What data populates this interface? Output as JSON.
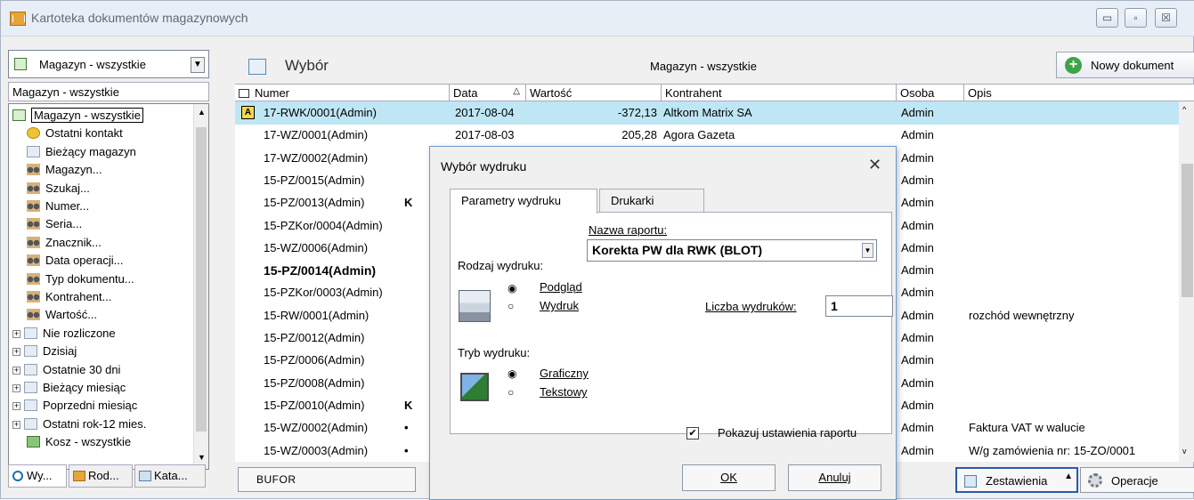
{
  "window": {
    "title": "Kartoteka dokumentów magazynowych",
    "min": "▭",
    "max": "▫",
    "close": "☒"
  },
  "left": {
    "combo": "Magazyn - wszystkie",
    "header": "Magazyn - wszystkie",
    "tree": [
      {
        "label": "Magazyn - wszystkie",
        "icon": "magazine-icon",
        "level": 0,
        "exp": ""
      },
      {
        "label": "Ostatni kontakt",
        "icon": "clock-icon",
        "level": 1,
        "exp": ""
      },
      {
        "label": "Bieżący magazyn",
        "icon": "grid-icon",
        "level": 1,
        "exp": ""
      },
      {
        "label": "Magazyn...",
        "icon": "binoculars-icon",
        "level": 1,
        "exp": ""
      },
      {
        "label": "Szukaj...",
        "icon": "binoculars-icon",
        "level": 1,
        "exp": ""
      },
      {
        "label": "Numer...",
        "icon": "binoculars-icon",
        "level": 1,
        "exp": ""
      },
      {
        "label": "Seria...",
        "icon": "binoculars-icon",
        "level": 1,
        "exp": ""
      },
      {
        "label": "Znacznik...",
        "icon": "binoculars-icon",
        "level": 1,
        "exp": ""
      },
      {
        "label": "Data operacji...",
        "icon": "binoculars-icon",
        "level": 1,
        "exp": ""
      },
      {
        "label": "Typ dokumentu...",
        "icon": "binoculars-icon",
        "level": 1,
        "exp": ""
      },
      {
        "label": "Kontrahent...",
        "icon": "binoculars-icon",
        "level": 1,
        "exp": ""
      },
      {
        "label": "Wartość...",
        "icon": "binoculars-icon",
        "level": 1,
        "exp": ""
      },
      {
        "label": "Nie rozliczone",
        "icon": "grid-icon",
        "level": 0,
        "exp": "+"
      },
      {
        "label": "Dzisiaj",
        "icon": "grid-icon",
        "level": 0,
        "exp": "+"
      },
      {
        "label": "Ostatnie 30 dni",
        "icon": "grid-icon",
        "level": 0,
        "exp": "+"
      },
      {
        "label": "Bieżący miesiąc",
        "icon": "grid-icon",
        "level": 0,
        "exp": "+"
      },
      {
        "label": "Poprzedni miesiąc",
        "icon": "grid-icon",
        "level": 0,
        "exp": "+"
      },
      {
        "label": "Ostatni rok-12 mies.",
        "icon": "grid-icon",
        "level": 0,
        "exp": "+"
      },
      {
        "label": "Kosz - wszystkie",
        "icon": "bin-icon",
        "level": 1,
        "exp": ""
      }
    ],
    "tabs": [
      "Wy...",
      "Rod...",
      "Kata..."
    ]
  },
  "main": {
    "title": "Wybór",
    "subtitle": "Magazyn - wszystkie",
    "new_doc": "Nowy dokument",
    "columns": [
      "Numer",
      "Data",
      "Wartość",
      "Kontrahent",
      "Osoba",
      "Opis"
    ],
    "rows": [
      {
        "flag": "A",
        "mark": "",
        "numer": "17-RWK/0001(Admin)",
        "data": "2017-08-04",
        "wartosc": "-372,13",
        "kontrahent": "Altkom Matrix SA",
        "osoba": "Admin",
        "opis": "",
        "bold": false
      },
      {
        "flag": "",
        "mark": "",
        "numer": "17-WZ/0001(Admin)",
        "data": "2017-08-03",
        "wartosc": "205,28",
        "kontrahent": "Agora Gazeta",
        "osoba": "Admin",
        "opis": "",
        "bold": false
      },
      {
        "flag": "",
        "mark": "",
        "numer": "17-WZ/0002(Admin)",
        "data": "",
        "wartosc": "",
        "kontrahent": "",
        "osoba": "Admin",
        "opis": "",
        "bold": false
      },
      {
        "flag": "",
        "mark": "",
        "numer": "15-PZ/0015(Admin)",
        "data": "",
        "wartosc": "",
        "kontrahent": "",
        "osoba": "Admin",
        "opis": "",
        "bold": false
      },
      {
        "flag": "",
        "mark": "K",
        "numer": "15-PZ/0013(Admin)",
        "data": "",
        "wartosc": "",
        "kontrahent": "",
        "osoba": "Admin",
        "opis": "",
        "bold": false
      },
      {
        "flag": "",
        "mark": "",
        "numer": "15-PZKor/0004(Admin)",
        "data": "",
        "wartosc": "",
        "kontrahent": "",
        "osoba": "Admin",
        "opis": "",
        "bold": false
      },
      {
        "flag": "",
        "mark": "",
        "numer": "15-WZ/0006(Admin)",
        "data": "",
        "wartosc": "",
        "kontrahent": "",
        "osoba": "Admin",
        "opis": "",
        "bold": false
      },
      {
        "flag": "",
        "mark": "",
        "numer": "15-PZ/0014(Admin)",
        "data": "",
        "wartosc": "",
        "kontrahent": "",
        "osoba": "Admin",
        "opis": "",
        "bold": true
      },
      {
        "flag": "",
        "mark": "",
        "numer": "15-PZKor/0003(Admin)",
        "data": "",
        "wartosc": "",
        "kontrahent": "",
        "osoba": "Admin",
        "opis": "",
        "bold": false
      },
      {
        "flag": "",
        "mark": "",
        "numer": "15-RW/0001(Admin)",
        "data": "",
        "wartosc": "",
        "kontrahent": "",
        "osoba": "Admin",
        "opis": "rozchód wewnętrzny",
        "bold": false
      },
      {
        "flag": "",
        "mark": "",
        "numer": "15-PZ/0012(Admin)",
        "data": "",
        "wartosc": "",
        "kontrahent": "",
        "osoba": "Admin",
        "opis": "",
        "bold": false
      },
      {
        "flag": "",
        "mark": "",
        "numer": "15-PZ/0006(Admin)",
        "data": "",
        "wartosc": "",
        "kontrahent": "",
        "osoba": "Admin",
        "opis": "",
        "bold": false
      },
      {
        "flag": "",
        "mark": "",
        "numer": "15-PZ/0008(Admin)",
        "data": "",
        "wartosc": "",
        "kontrahent": "",
        "osoba": "Admin",
        "opis": "",
        "bold": false
      },
      {
        "flag": "",
        "mark": "K",
        "numer": "15-PZ/0010(Admin)",
        "data": "",
        "wartosc": "",
        "kontrahent": "",
        "osoba": "Admin",
        "opis": "",
        "bold": false
      },
      {
        "flag": "",
        "mark": "•",
        "numer": "15-WZ/0002(Admin)",
        "data": "",
        "wartosc": "",
        "kontrahent": "",
        "osoba": "Admin",
        "opis": "Faktura VAT w walucie",
        "bold": false
      },
      {
        "flag": "",
        "mark": "•",
        "numer": "15-WZ/0003(Admin)",
        "data": "",
        "wartosc": "",
        "kontrahent": "",
        "osoba": "Admin",
        "opis": "W/g zamówienia nr: 15-ZO/0001",
        "bold": false
      }
    ],
    "bufor": "BUFOR",
    "zestawienia": "Zestawienia",
    "operacje": "Operacje"
  },
  "dialog": {
    "title": "Wybór wydruku",
    "close": "✕",
    "tab_params": "Parametry wydruku",
    "tab_printers": "Drukarki",
    "report_name_label": "Nazwa raportu:",
    "report_name": "Korekta PW dla RWK (BLOT)",
    "print_type_label": "Rodzaj wydruku:",
    "preview": "Podgląd",
    "print": "Wydruk",
    "copies_label": "Liczba wydruków:",
    "copies": "1",
    "mode_label": "Tryb wydruku:",
    "graphic": "Graficzny",
    "text": "Tekstowy",
    "show_settings": "Pokazuj ustawienia raportu",
    "ok": "OK",
    "cancel": "Anuluj"
  },
  "colors": {
    "selection": "#bfe6f5",
    "dialog_border": "#6a9ccd",
    "accent": "#3ea447"
  }
}
